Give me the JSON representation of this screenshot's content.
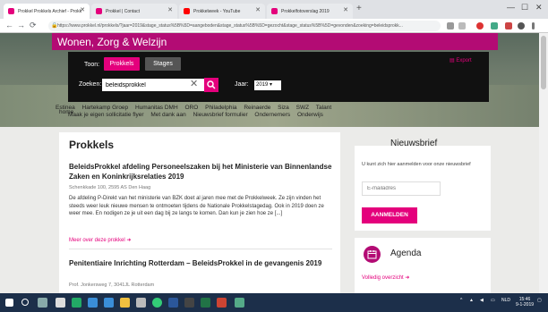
{
  "browser": {
    "tabs": [
      {
        "label": "Prokkel Prokkels Archief - Prokk"
      },
      {
        "label": "Prokkel | Contact"
      },
      {
        "label": "Prokkelweek - YouTube"
      },
      {
        "label": "Prokkelfotoverslag 2019"
      }
    ],
    "url": "https://www.prokkel.nl/prokkels/?jaar=2019&stage_status%5B%5D=aangeboden&stage_status%5B%5D=gezocht&stage_status%5B%5D=gevonden&zoeking=beleidsprokk..."
  },
  "site": {
    "title": "Wonen, Zorg & Welzijn",
    "toon_label": "Toon:",
    "toggle_prokkels": "Prokkels",
    "toggle_stages": "Stages",
    "search_label": "Zoeken:",
    "search_value": "beleidsprokkel",
    "year_label": "Jaar:",
    "year_value": "2019 ▾",
    "export_label": "Export",
    "filter_links": [
      "Estinea",
      "Hartekamp Groep",
      "Humanitas DMH",
      "ORO",
      "Philadelphia",
      "Reinaerde",
      "Siza",
      "SWZ",
      "Talant",
      "Maak je eigen sollicitatie flyer",
      "Met dank aan",
      "Nieuwsbrief formulier",
      "Ondernemers",
      "Onderwijs"
    ],
    "home_label": "home"
  },
  "main": {
    "page_title": "Prokkels",
    "posts": [
      {
        "title": "BeleidsProkkel afdeling Personeelszaken bij het Ministerie van Binnenlandse Zaken en Koninkrijksrelaties 2019",
        "address": "Schenkkade 100, 2595 AS Den Haag",
        "body": "De afdeling P-Direkt van het ministerie van BZK doet al jaren mee met de Prokkelweek. Ze zijn vinden het steeds weer leuk nieuwe mensen te ontmoeten tijdens de Nationale Prokkelstagedag. Ook in 2019 doen ze weer mee. En nodigen ze je uit een dag bij ze langs te komen. Dan kun je zien hoe ze [...]",
        "more": "Meer over deze prokkel ➜"
      },
      {
        "title": "Penitentiaire Inrichting Rotterdam – BeleidsProkkel in de gevangenis 2019",
        "address": "Prof. Jonkersweg 7, 3041JL Rotterdam"
      }
    ]
  },
  "sidebar": {
    "newsletter_title": "Nieuwsbrief",
    "newsletter_text": "U kunt zich hier aanmelden voor onze nieuwsbrief",
    "email_placeholder": "E-mailadres",
    "subscribe_label": "AANMELDEN",
    "agenda_title": "Agenda",
    "agenda_link": "Volledig overzicht ➜"
  },
  "taskbar": {
    "time": "15:46",
    "date": "9-1-2019",
    "lang": "NLD"
  },
  "colors": {
    "brand": "#b30b74",
    "accent": "#e4007c",
    "taskbar": "#1c2f4a"
  }
}
